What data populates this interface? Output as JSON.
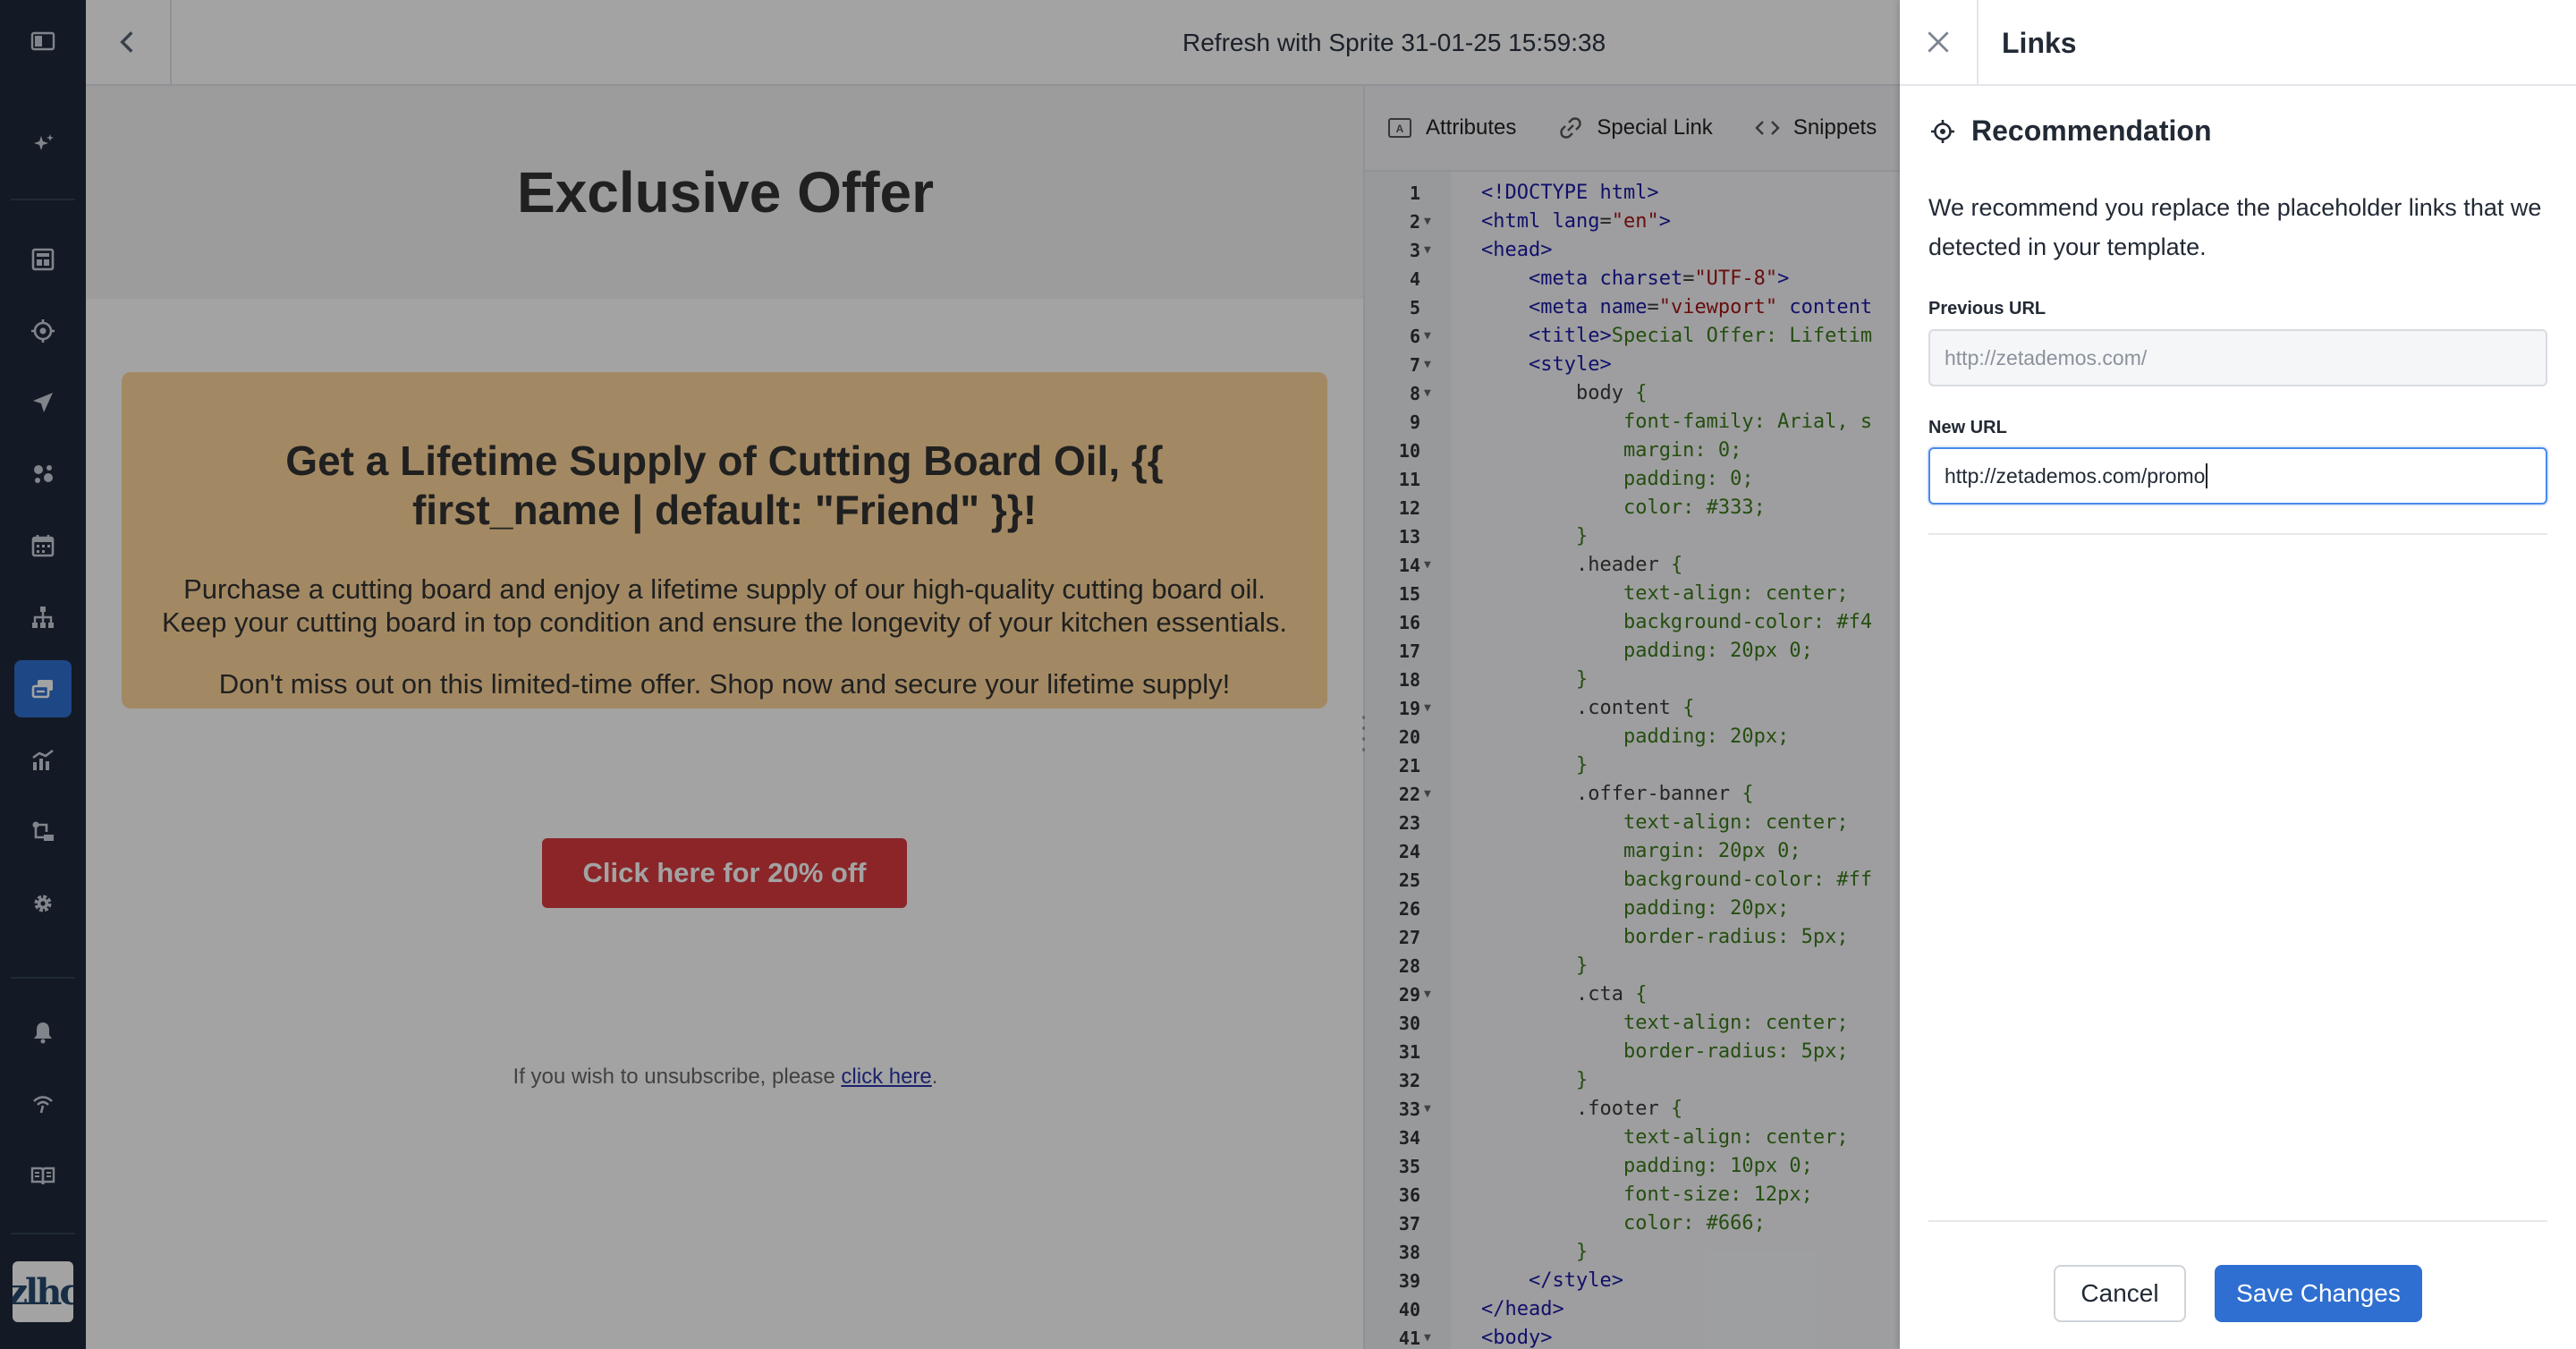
{
  "window": {
    "title": "Refresh with Sprite 31-01-25 15:59:38"
  },
  "nav": {
    "items": [
      {
        "icon": "panel-toggle-icon"
      },
      {
        "icon": "sparkle-icon"
      },
      {
        "icon": "dashboard-icon"
      },
      {
        "icon": "target-icon"
      },
      {
        "icon": "send-icon"
      },
      {
        "icon": "audience-icon"
      },
      {
        "icon": "calendar-icon"
      },
      {
        "icon": "hierarchy-icon"
      },
      {
        "icon": "content-icon"
      },
      {
        "icon": "analytics-icon"
      },
      {
        "icon": "workflow-icon"
      },
      {
        "icon": "gear-icon"
      },
      {
        "icon": "bell-icon"
      },
      {
        "icon": "signal-icon"
      },
      {
        "icon": "book-icon"
      }
    ],
    "active": "content-icon",
    "logo_text": "zlhc"
  },
  "preview": {
    "header": "Exclusive Offer",
    "offer_title": "Get a Lifetime Supply of Cutting Board Oil, {{ first_name | default: \"Friend\" }}!",
    "offer_body": "Purchase a cutting board and enjoy a lifetime supply of our high-quality cutting board oil. Keep your cutting board in top condition and ensure the longevity of your kitchen essentials.",
    "offer_tail": "Don't miss out on this limited-time offer. Shop now and secure your lifetime supply!",
    "cta": "Click here for 20% off",
    "footer_prefix": "If you wish to unsubscribe, please ",
    "footer_link": "click here",
    "footer_suffix": "."
  },
  "code_tabs": {
    "attributes": "Attributes",
    "special_link": "Special Link",
    "snippets": "Snippets"
  },
  "code": [
    {
      "n": "1",
      "fold": false,
      "html": "<span class=\"tag\">&lt;!DOCTYPE html&gt;</span>"
    },
    {
      "n": "2",
      "fold": true,
      "html": "<span class=\"tag\">&lt;html</span> <span class=\"attr\">lang</span>=<span class=\"str\">\"en\"</span><span class=\"tag\">&gt;</span>"
    },
    {
      "n": "3",
      "fold": true,
      "html": "<span class=\"tag\">&lt;head&gt;</span>"
    },
    {
      "n": "4",
      "fold": false,
      "html": "    <span class=\"tag\">&lt;meta</span> <span class=\"attr\">charset</span>=<span class=\"str\">\"UTF-8\"</span><span class=\"tag\">&gt;</span>"
    },
    {
      "n": "5",
      "fold": false,
      "html": "    <span class=\"tag\">&lt;meta</span> <span class=\"attr\">name</span>=<span class=\"str\">\"viewport\"</span> <span class=\"attr\">content</span>"
    },
    {
      "n": "6",
      "fold": true,
      "html": "    <span class=\"tag\">&lt;title&gt;</span><span class=\"txt\">Special Offer: Lifetim</span>"
    },
    {
      "n": "7",
      "fold": true,
      "html": "    <span class=\"tag\">&lt;style&gt;</span>"
    },
    {
      "n": "8",
      "fold": true,
      "html": "        <span class=\"sel\">body</span> <span class=\"txt\">{</span>"
    },
    {
      "n": "9",
      "fold": false,
      "html": "            <span class=\"txt\">font-family: Arial, s</span>"
    },
    {
      "n": "10",
      "fold": false,
      "html": "            <span class=\"txt\">margin: 0;</span>"
    },
    {
      "n": "11",
      "fold": false,
      "html": "            <span class=\"txt\">padding: 0;</span>"
    },
    {
      "n": "12",
      "fold": false,
      "html": "            <span class=\"txt\">color: #333;</span>"
    },
    {
      "n": "13",
      "fold": false,
      "html": "        <span class=\"txt\">}</span>"
    },
    {
      "n": "14",
      "fold": true,
      "html": "        <span class=\"sel\">.header</span> <span class=\"txt\">{</span>"
    },
    {
      "n": "15",
      "fold": false,
      "html": "            <span class=\"txt\">text-align: center;</span>"
    },
    {
      "n": "16",
      "fold": false,
      "html": "            <span class=\"txt\">background-color: #f4</span>"
    },
    {
      "n": "17",
      "fold": false,
      "html": "            <span class=\"txt\">padding: 20px 0;</span>"
    },
    {
      "n": "18",
      "fold": false,
      "html": "        <span class=\"txt\">}</span>"
    },
    {
      "n": "19",
      "fold": true,
      "html": "        <span class=\"sel\">.content</span> <span class=\"txt\">{</span>"
    },
    {
      "n": "20",
      "fold": false,
      "html": "            <span class=\"txt\">padding: 20px;</span>"
    },
    {
      "n": "21",
      "fold": false,
      "html": "        <span class=\"txt\">}</span>"
    },
    {
      "n": "22",
      "fold": true,
      "html": "        <span class=\"sel\">.offer-banner</span> <span class=\"txt\">{</span>"
    },
    {
      "n": "23",
      "fold": false,
      "html": "            <span class=\"txt\">text-align: center;</span>"
    },
    {
      "n": "24",
      "fold": false,
      "html": "            <span class=\"txt\">margin: 20px 0;</span>"
    },
    {
      "n": "25",
      "fold": false,
      "html": "            <span class=\"txt\">background-color: #ff</span>"
    },
    {
      "n": "26",
      "fold": false,
      "html": "            <span class=\"txt\">padding: 20px;</span>"
    },
    {
      "n": "27",
      "fold": false,
      "html": "            <span class=\"txt\">border-radius: 5px;</span>"
    },
    {
      "n": "28",
      "fold": false,
      "html": "        <span class=\"txt\">}</span>"
    },
    {
      "n": "29",
      "fold": true,
      "html": "        <span class=\"sel\">.cta</span> <span class=\"txt\">{</span>"
    },
    {
      "n": "30",
      "fold": false,
      "html": "            <span class=\"txt\">text-align: center;</span>"
    },
    {
      "n": "31",
      "fold": false,
      "html": "            <span class=\"txt\">border-radius: 5px;</span>"
    },
    {
      "n": "32",
      "fold": false,
      "html": "        <span class=\"txt\">}</span>"
    },
    {
      "n": "33",
      "fold": true,
      "html": "        <span class=\"sel\">.footer</span> <span class=\"txt\">{</span>"
    },
    {
      "n": "34",
      "fold": false,
      "html": "            <span class=\"txt\">text-align: center;</span>"
    },
    {
      "n": "35",
      "fold": false,
      "html": "            <span class=\"txt\">padding: 10px 0;</span>"
    },
    {
      "n": "36",
      "fold": false,
      "html": "            <span class=\"txt\">font-size: 12px;</span>"
    },
    {
      "n": "37",
      "fold": false,
      "html": "            <span class=\"txt\">color: #666;</span>"
    },
    {
      "n": "38",
      "fold": false,
      "html": "        <span class=\"txt\">}</span>"
    },
    {
      "n": "39",
      "fold": false,
      "html": "    <span class=\"tag\">&lt;/style&gt;</span>"
    },
    {
      "n": "40",
      "fold": false,
      "html": "<span class=\"tag\">&lt;/head&gt;</span>"
    },
    {
      "n": "41",
      "fold": true,
      "html": "<span class=\"tag\">&lt;body&gt;</span>"
    }
  ],
  "drawer": {
    "title": "Links",
    "rec_title": "Recommendation",
    "rec_desc": "We recommend you replace the placeholder links that we detected in your template.",
    "prev_label": "Previous URL",
    "prev_value": "http://zetademos.com/",
    "new_label": "New URL",
    "new_value": "http://zetademos.com/promo",
    "cancel": "Cancel",
    "save": "Save Changes"
  },
  "colors": {
    "rail": "#1e2a3a",
    "accent": "#2f6fd1",
    "cta": "#d93a3f",
    "banner": "#ffd79b"
  }
}
